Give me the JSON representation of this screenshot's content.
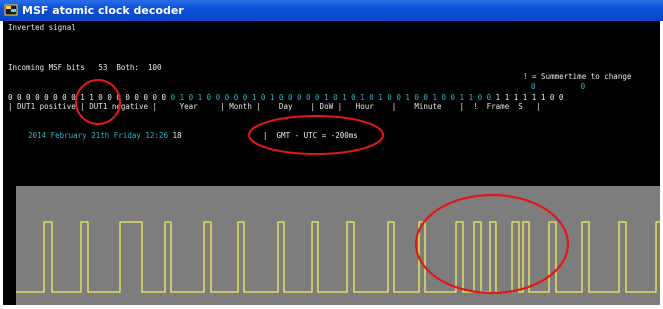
{
  "window": {
    "title": "MSF atomic clock decoder"
  },
  "console": {
    "signal_mode": "Inverted signal",
    "incoming_label": "Incoming MSF bits",
    "incoming_count": "53",
    "both_label": "Both:",
    "both_count": "100",
    "summertime_note": "! = Summertime to change",
    "summertime_bits": "0          0",
    "bit_row_white": "0 0 0 0 0 0 0 0 1 1 0 0 0 0 0 0 0 0",
    "bit_row_cyan": "0 1 0 1 0 0 0 0 0 1 0 1 0 0 0 0 0 1 0 1 0 1 0 1 0 0 1 0 0 1 0 0 1 1 0 0",
    "bit_row_tail": "1 1 1 1 1 1 0 0",
    "field_labels": "| DUT1 positive | DUT1 negative |     Year     | Month |    Day    | DoW |   Hour    |    Minute    |  !  Frame  S   |",
    "decoded_date": "2014 February 21th Friday 12:26",
    "decoded_seconds": "18",
    "gmt_utc": "|  GMT - UTC = -200ms"
  },
  "scope": {
    "trace_color": "#f2ef5a",
    "background_color": "#7d7d7d"
  },
  "annotations": {
    "color": "#e01818"
  }
}
